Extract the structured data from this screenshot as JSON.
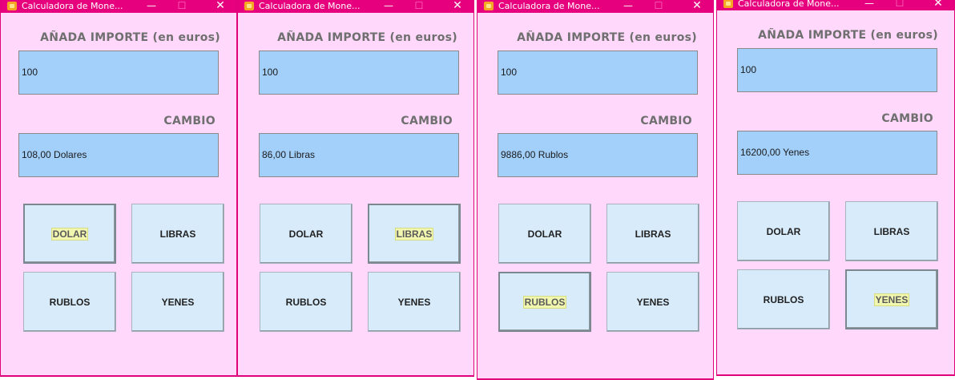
{
  "windows": [
    {
      "title": "Calculadora de Mone...",
      "amount_label": "AÑADA IMPORTE",
      "amount_label_suffix": "(en euros)",
      "amount_value": "100",
      "result_label": "CAMBIO",
      "result_value": "108,00 Dolares",
      "buttons": [
        "DOLAR",
        "LIBRAS",
        "RUBLOS",
        "YENES"
      ],
      "active_button": "DOLAR"
    },
    {
      "title": "Calculadora de Mone...",
      "amount_label": "AÑADA IMPORTE",
      "amount_label_suffix": "(en euros)",
      "amount_value": "100",
      "result_label": "CAMBIO",
      "result_value": "86,00 Libras",
      "buttons": [
        "DOLAR",
        "LIBRAS",
        "RUBLOS",
        "YENES"
      ],
      "active_button": "LIBRAS"
    },
    {
      "title": "Calculadora de Mone...",
      "amount_label": "AÑADA IMPORTE",
      "amount_label_suffix": "(en euros)",
      "amount_value": "100",
      "result_label": "CAMBIO",
      "result_value": "9886,00 Rublos",
      "buttons": [
        "DOLAR",
        "LIBRAS",
        "RUBLOS",
        "YENES"
      ],
      "active_button": "RUBLOS"
    },
    {
      "title": "Calculadora de Mone...",
      "amount_label": "AÑADA IMPORTE",
      "amount_label_suffix": "(en euros)",
      "amount_value": "100",
      "result_label": "CAMBIO",
      "result_value": "16200,00 Yenes",
      "buttons": [
        "DOLAR",
        "LIBRAS",
        "RUBLOS",
        "YENES"
      ],
      "active_button": "YENES"
    }
  ],
  "colors": {
    "titlebar": "#e6007e",
    "window_bg": "#ffd8fb",
    "field_bg": "#a3d0fb",
    "button_bg": "#d7ebfa",
    "label_text": "#6f6f6f"
  },
  "icons": {
    "app": "java-app-icon",
    "minimize": "minimize-icon",
    "maximize": "maximize-icon",
    "close": "close-icon"
  }
}
